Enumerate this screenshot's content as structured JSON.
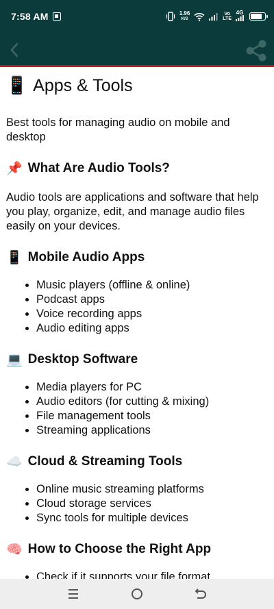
{
  "status_bar": {
    "time": "7:58 AM",
    "net_speed_value": "1.96",
    "net_speed_unit": "K/S",
    "volte_top": "Vo",
    "volte_bottom": "LTE",
    "network_type": "4G",
    "battery_level": 0.85,
    "icons": [
      "sim-icon",
      "vibrate-icon",
      "wifi-icon",
      "signal-icon",
      "battery-icon"
    ]
  },
  "app_bar": {
    "background": "#0b3b3a",
    "accent_border": "#c8151b",
    "icons": [
      "back-icon",
      "share-icon"
    ]
  },
  "content": {
    "title_emoji": "📱",
    "title": "Apps & Tools",
    "intro": "Best tools for managing audio on mobile and desktop",
    "sections": [
      {
        "emoji": "📌",
        "heading": "What Are Audio Tools?",
        "paragraph": "Audio tools are applications and software that help you play, organize, edit, and manage audio files easily on your devices."
      },
      {
        "emoji": "📱",
        "heading": "Mobile Audio Apps",
        "items": [
          "Music players (offline & online)",
          "Podcast apps",
          "Voice recording apps",
          "Audio editing apps"
        ]
      },
      {
        "emoji": "💻",
        "heading": "Desktop Software",
        "items": [
          "Media players for PC",
          "Audio editors (for cutting & mixing)",
          "File management tools",
          "Streaming applications"
        ]
      },
      {
        "emoji": "☁️",
        "heading": "Cloud & Streaming Tools",
        "items": [
          "Online music streaming platforms",
          "Cloud storage services",
          "Sync tools for multiple devices"
        ]
      },
      {
        "emoji": "🧠",
        "heading": "How to Choose the Right App",
        "items": [
          "Check if it supports your file format"
        ]
      }
    ]
  },
  "nav_bar": {
    "icons": [
      "recents-icon",
      "home-icon",
      "back-nav-icon"
    ]
  }
}
